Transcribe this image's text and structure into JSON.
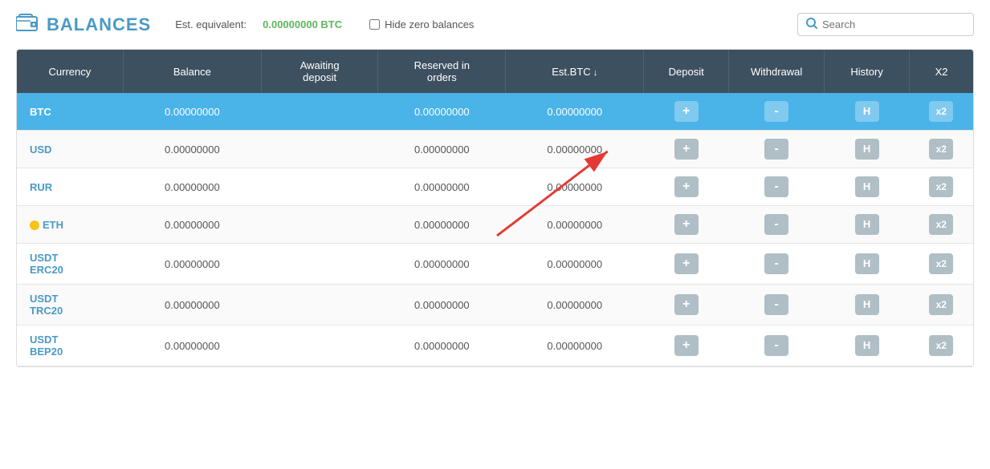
{
  "header": {
    "title": "BALANCES",
    "est_label": "Est. equivalent:",
    "est_value": "0.00000000 BTC",
    "hide_zero_label": "Hide zero balances",
    "search_placeholder": "Search"
  },
  "table": {
    "columns": [
      {
        "key": "currency",
        "label": "Currency"
      },
      {
        "key": "balance",
        "label": "Balance"
      },
      {
        "key": "awaiting",
        "label": "Awaiting deposit"
      },
      {
        "key": "reserved",
        "label": "Reserved in orders"
      },
      {
        "key": "estbtc",
        "label": "Est.BTC",
        "sort": true
      },
      {
        "key": "deposit",
        "label": "Deposit"
      },
      {
        "key": "withdrawal",
        "label": "Withdrawal"
      },
      {
        "key": "history",
        "label": "History"
      },
      {
        "key": "x2",
        "label": "X2"
      }
    ],
    "rows": [
      {
        "currency": "BTC",
        "balance": "0.00000000",
        "awaiting": "",
        "reserved": "0.00000000",
        "estbtc": "0.00000000",
        "selected": true
      },
      {
        "currency": "USD",
        "balance": "0.00000000",
        "awaiting": "",
        "reserved": "0.00000000",
        "estbtc": "0.00000000",
        "selected": false
      },
      {
        "currency": "RUR",
        "balance": "0.00000000",
        "awaiting": "",
        "reserved": "0.00000000",
        "estbtc": "0.00000000",
        "selected": false
      },
      {
        "currency": "ETH",
        "balance": "0.00000000",
        "awaiting": "",
        "reserved": "0.00000000",
        "estbtc": "0.00000000",
        "selected": false,
        "dot": true
      },
      {
        "currency": "USDT\nERC20",
        "balance": "0.00000000",
        "awaiting": "",
        "reserved": "0.00000000",
        "estbtc": "0.00000000",
        "selected": false
      },
      {
        "currency": "USDT\nTRC20",
        "balance": "0.00000000",
        "awaiting": "",
        "reserved": "0.00000000",
        "estbtc": "0.00000000",
        "selected": false
      },
      {
        "currency": "USDT\nBEP20",
        "balance": "0.00000000",
        "awaiting": "",
        "reserved": "0.00000000",
        "estbtc": "0.00000000",
        "selected": false
      }
    ],
    "btn_deposit": "+",
    "btn_withdrawal": "-",
    "btn_history": "H",
    "btn_x2": "x2"
  }
}
